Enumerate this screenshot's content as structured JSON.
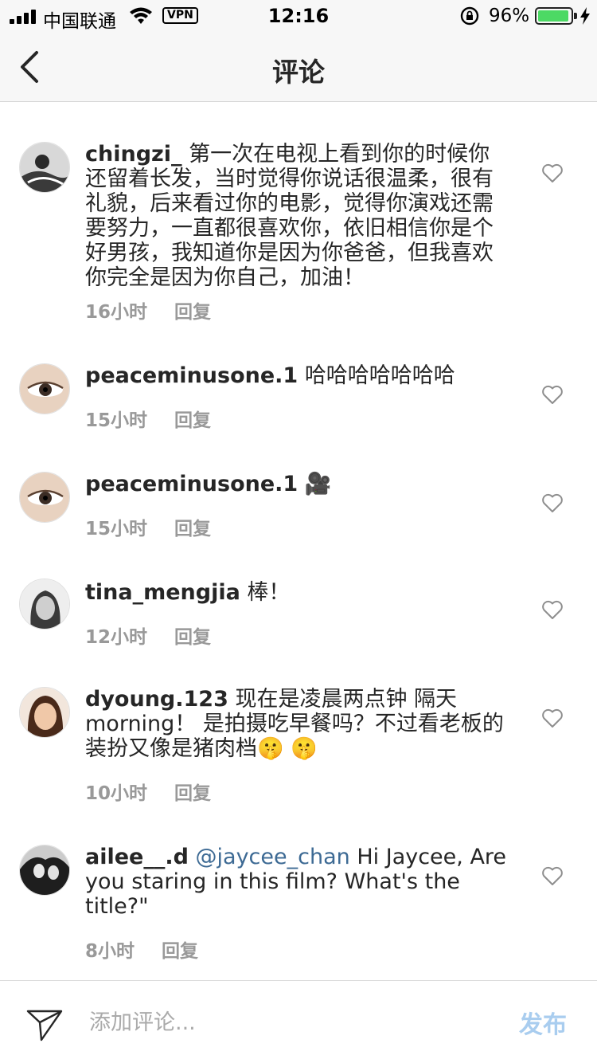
{
  "status_bar": {
    "carrier": "中国联通",
    "vpn": "VPN",
    "time": "12:16",
    "battery_percent": "96%",
    "battery_level": 0.96,
    "battery_color": "#4cd964"
  },
  "nav": {
    "title": "评论",
    "back_icon": "chevron-left-icon"
  },
  "comments": [
    {
      "username": "chingzi_",
      "text": "第一次在电视上看到你的时候你还留着长发，当时觉得你说话很温柔，很有礼貌，后来看过你的电影，觉得你演戏还需要努力，一直都很喜欢你，依旧相信你是个好男孩，我知道你是因为你爸爸，但我喜欢你完全是因为你自己，加油！",
      "time": "16小时",
      "reply": "回复"
    },
    {
      "username": "peaceminusone.1",
      "text": "哈哈哈哈哈哈哈",
      "time": "15小时",
      "reply": "回复"
    },
    {
      "username": "peaceminusone.1",
      "text": "🎥",
      "time": "15小时",
      "reply": "回复"
    },
    {
      "username": "tina_mengjia",
      "text": "棒！",
      "time": "12小时",
      "reply": "回复"
    },
    {
      "username": "dyoung.123",
      "text": "现在是凌晨两点钟 隔天morning！ 是拍摄吃早餐吗？不过看老板的装扮又像是猪肉档🤫 🤫",
      "time": "10小时",
      "reply": "回复"
    },
    {
      "username": "ailee__.d",
      "mention": "@jaycee_chan",
      "text": "Hi Jaycee, Are you staring in this film?  What's the title?\"",
      "time": "8小时",
      "reply": "回复"
    }
  ],
  "composer": {
    "placeholder": "添加评论...",
    "post_label": "发布",
    "send_icon": "paper-plane-icon",
    "post_color": "#a9cdef"
  },
  "colors": {
    "mention": "#3d6a94",
    "meta": "#999999",
    "text": "#262626"
  }
}
